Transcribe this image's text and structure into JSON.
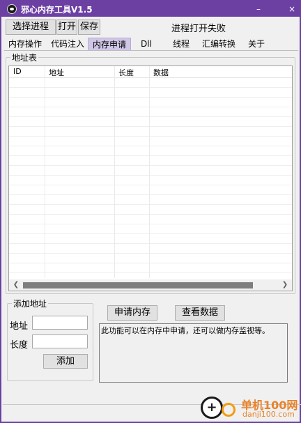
{
  "window": {
    "title": "邪心内存工具V1.5",
    "minimize_glyph": "–",
    "close_glyph": "×",
    "accent": "#6c3fa3"
  },
  "toolbar": {
    "select_process_label": "选择进程",
    "open_label": "打开",
    "save_label": "保存",
    "status_text": "进程打开失败"
  },
  "tabs": [
    {
      "label": "内存操作",
      "active": false
    },
    {
      "label": "代码注入",
      "active": false
    },
    {
      "label": "内存申请",
      "active": true
    },
    {
      "label": "Dll",
      "active": false
    },
    {
      "label": "线程",
      "active": false
    },
    {
      "label": "汇编转换",
      "active": false
    },
    {
      "label": "关于",
      "active": false
    }
  ],
  "address_table": {
    "group_title": "地址表",
    "columns": [
      "ID",
      "地址",
      "长度",
      "数据"
    ],
    "rows": []
  },
  "add_address": {
    "group_title": "添加地址",
    "address_label": "地址",
    "address_value": "",
    "length_label": "长度",
    "length_value": "",
    "add_button_label": "添加"
  },
  "actions": {
    "allocate_label": "申请内存",
    "view_data_label": "查看数据",
    "info_text": "此功能可以在内存中申请，还可以做内存监视等。"
  },
  "watermark": {
    "title": "单机100网",
    "url": "danji100.com"
  }
}
